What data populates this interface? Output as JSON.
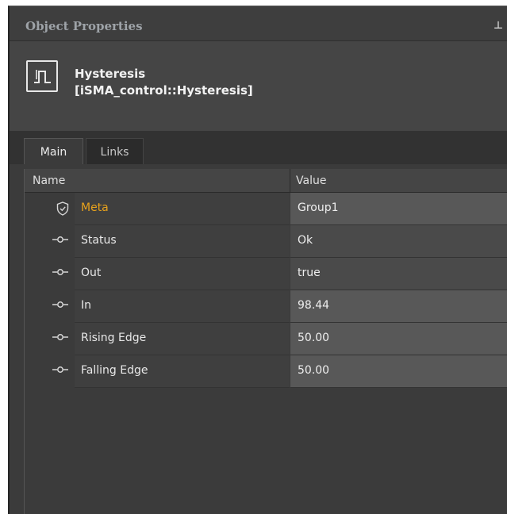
{
  "panel": {
    "title": "Object Properties",
    "pin_glyph": "⊥"
  },
  "object": {
    "name": "Hysteresis",
    "type": "[iSMA_control::Hysteresis]",
    "icon": "hysteresis-icon"
  },
  "tabs": [
    {
      "label": "Main",
      "active": true
    },
    {
      "label": "Links",
      "active": false
    }
  ],
  "table": {
    "columns": {
      "name": "Name",
      "value": "Value"
    },
    "rows": [
      {
        "icon": "shield-icon",
        "name": "Meta",
        "value": "Group1"
      },
      {
        "icon": "slot-icon",
        "name": "Status",
        "value": "Ok"
      },
      {
        "icon": "slot-icon",
        "name": "Out",
        "value": "true"
      },
      {
        "icon": "slot-icon",
        "name": "In",
        "value": "98.44"
      },
      {
        "icon": "slot-icon",
        "name": "Rising Edge",
        "value": "50.00"
      },
      {
        "icon": "slot-icon",
        "name": "Falling Edge",
        "value": "50.00"
      }
    ]
  },
  "colors": {
    "meta_accent": "#e8a21c",
    "panel_bg": "#3b3b3b"
  }
}
